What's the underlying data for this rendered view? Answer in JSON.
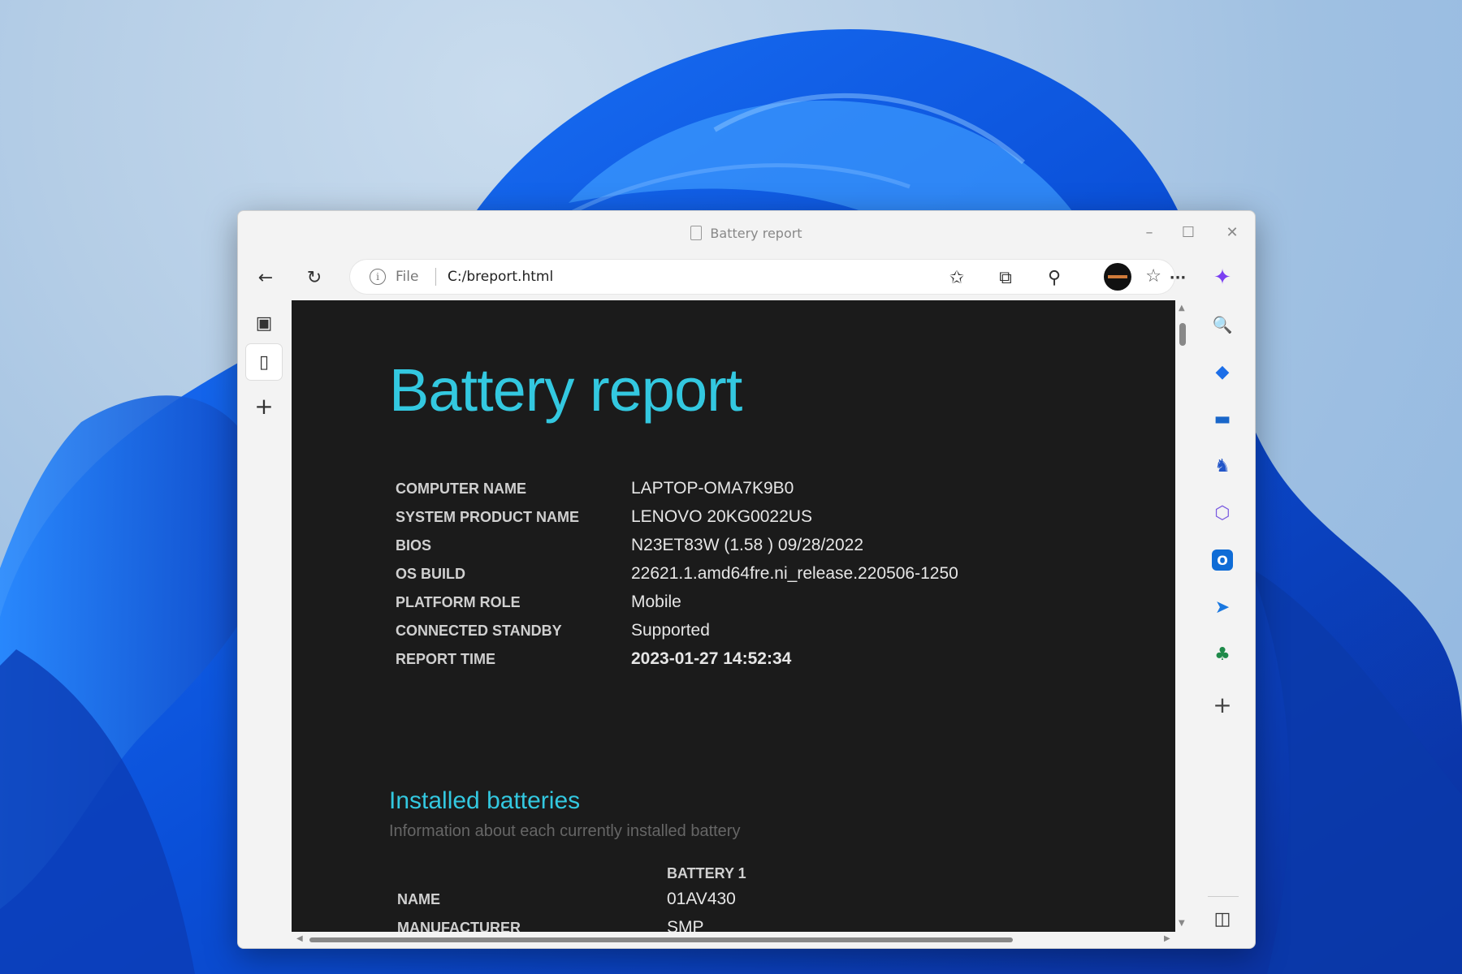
{
  "window": {
    "title": "Battery report"
  },
  "titlebar_controls": {
    "minimize": "–",
    "maximize": "☐",
    "close": "✕"
  },
  "toolbar": {
    "back": "←",
    "refresh": "↻",
    "address": {
      "info": "i",
      "scheme": "File",
      "url": "C:/breport.html"
    },
    "read_aloud": "A͓",
    "add_favorite": "☆",
    "favorites": "✩",
    "collections": "⧉",
    "extensions": "⚲",
    "more": "···",
    "copilot": "✦"
  },
  "vertical_tabs": {
    "toggle": "▣",
    "page": "▯",
    "new_tab": "+"
  },
  "report": {
    "title": "Battery report",
    "info_rows": [
      {
        "label": "COMPUTER NAME",
        "value": "LAPTOP-OMA7K9B0"
      },
      {
        "label": "SYSTEM PRODUCT NAME",
        "value": "LENOVO 20KG0022US"
      },
      {
        "label": "BIOS",
        "value": "N23ET83W (1.58 ) 09/28/2022"
      },
      {
        "label": "OS BUILD",
        "value": "22621.1.amd64fre.ni_release.220506-1250"
      },
      {
        "label": "PLATFORM ROLE",
        "value": "Mobile"
      },
      {
        "label": "CONNECTED STANDBY",
        "value": "Supported"
      },
      {
        "label": "REPORT TIME",
        "value": "2023-01-27   14:52:34"
      }
    ],
    "installed": {
      "title": "Installed batteries",
      "subtitle": "Information about each currently installed battery",
      "column_header": "BATTERY 1",
      "rows": [
        {
          "label": "NAME",
          "value": "01AV430"
        },
        {
          "label": "MANUFACTURER",
          "value": "SMP"
        }
      ]
    }
  },
  "sidebar": {
    "search": "🔍",
    "shopping": "◆",
    "tools": "▬",
    "games": "♞",
    "office": "⬡",
    "outlook": "O",
    "drop": "➤",
    "tree": "♣",
    "add": "+",
    "split": "◫",
    "settings": "⚙"
  },
  "colors": {
    "accent": "#33c8e0",
    "page_bg": "#1b1b1b"
  }
}
